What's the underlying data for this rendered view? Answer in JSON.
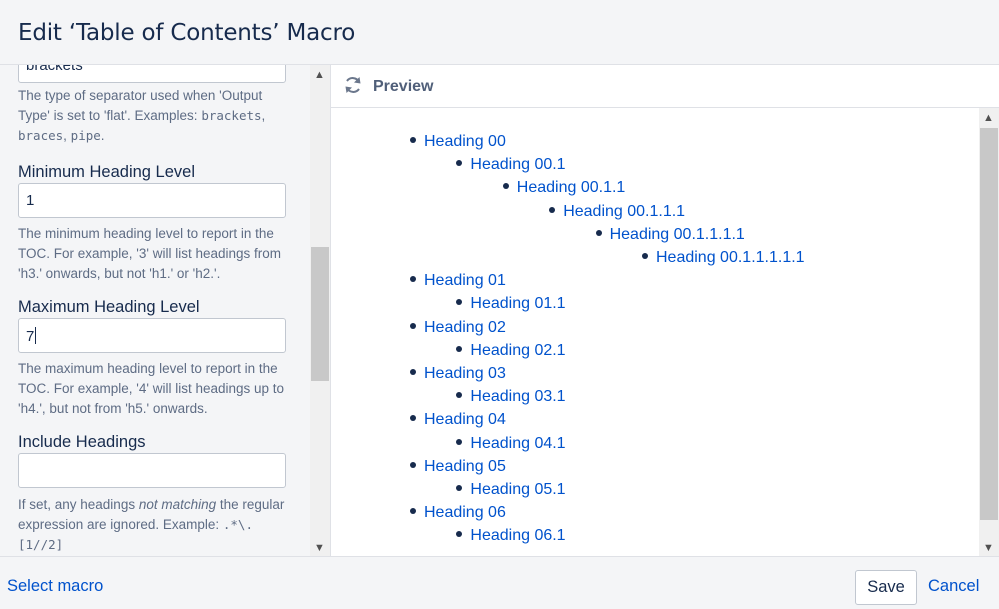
{
  "dialog": {
    "title": "Edit ‘Table of Contents’ Macro"
  },
  "left": {
    "separator_value": "brackets",
    "separator_help_a": "The type of separator used when 'Output Type' is set to 'flat'. Examples: ",
    "separator_ex1": "brackets",
    "separator_ex2": "braces",
    "separator_ex3": "pipe",
    "min_label": "Minimum Heading Level",
    "min_value": "1",
    "min_help": "The minimum heading level to report in the TOC. For example, '3' will list headings from 'h3.' onwards, but not 'h1.' or 'h2.'.",
    "max_label": "Maximum Heading Level",
    "max_value": "7",
    "max_help": "The maximum heading level to report in the TOC. For example, '4' will list headings up to 'h4.', but not from 'h5.' onwards.",
    "include_label": "Include Headings",
    "include_value": "",
    "include_help_a": "If set, any headings ",
    "include_help_em": "not matching",
    "include_help_b": " the regular expression are ignored. Example: ",
    "include_help_code": ".*\\.[1//2]"
  },
  "preview": {
    "label": "Preview",
    "items": [
      {
        "text": "Heading 00",
        "level": 1
      },
      {
        "text": "Heading 00.1",
        "level": 2
      },
      {
        "text": "Heading 00.1.1",
        "level": 3
      },
      {
        "text": "Heading 00.1.1.1",
        "level": 4
      },
      {
        "text": "Heading 00.1.1.1.1",
        "level": 5
      },
      {
        "text": "Heading 00.1.1.1.1.1",
        "level": 6
      },
      {
        "text": "Heading 01",
        "level": 1
      },
      {
        "text": "Heading 01.1",
        "level": 2
      },
      {
        "text": "Heading 02",
        "level": 1
      },
      {
        "text": "Heading 02.1",
        "level": 2
      },
      {
        "text": "Heading 03",
        "level": 1
      },
      {
        "text": "Heading 03.1",
        "level": 2
      },
      {
        "text": "Heading 04",
        "level": 1
      },
      {
        "text": "Heading 04.1",
        "level": 2
      },
      {
        "text": "Heading 05",
        "level": 1
      },
      {
        "text": "Heading 05.1",
        "level": 2
      },
      {
        "text": "Heading 06",
        "level": 1
      },
      {
        "text": "Heading 06.1",
        "level": 2
      }
    ]
  },
  "footer": {
    "select_macro": "Select macro",
    "save": "Save",
    "cancel": "Cancel"
  },
  "colors": {
    "link": "#0052cc",
    "text": "#172b4d",
    "panel": "#f4f5f7"
  }
}
